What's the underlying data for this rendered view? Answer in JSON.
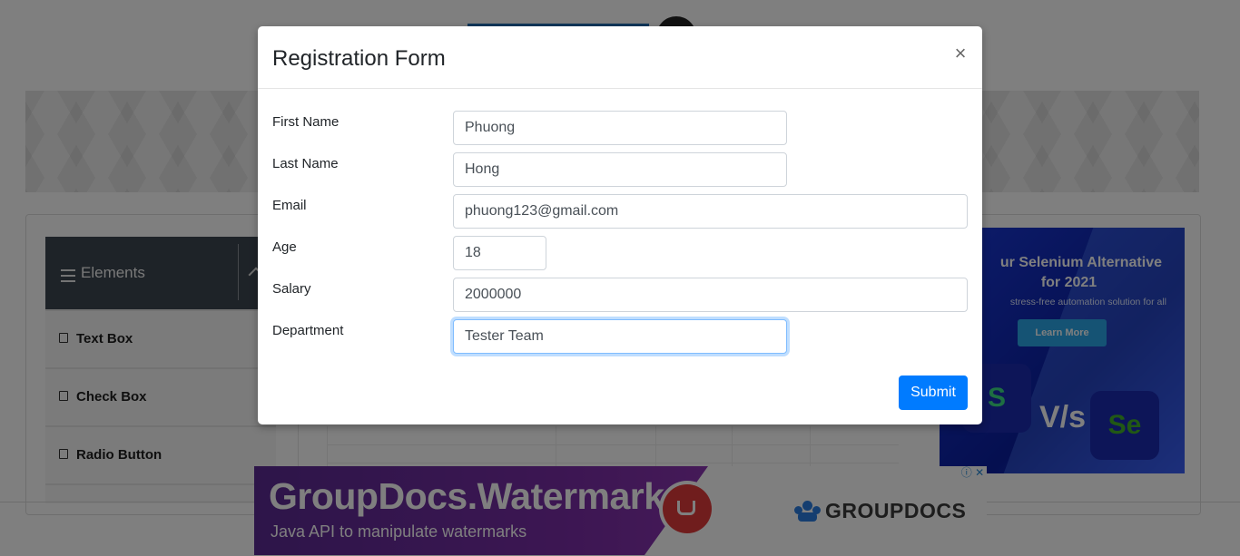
{
  "page": {
    "sidebar": {
      "group_title": "Elements",
      "items": [
        {
          "label": "Text Box"
        },
        {
          "label": "Check Box"
        },
        {
          "label": "Radio Button"
        }
      ]
    }
  },
  "ads": {
    "right": {
      "headline_line1": "ur Selenium Alternative",
      "headline_line2": "for 2021",
      "subtext": "stress-free automation solution for all",
      "button_label": "Learn More",
      "vs_text": "V/s",
      "tile_left_letter": "S",
      "tile_right_letter": "Se"
    },
    "bottom": {
      "title": "GroupDocs.Watermark",
      "subtitle": "Java API to manipulate watermarks",
      "brand": "GROUPDOCS"
    },
    "close_glyph": "ⓘ ✕"
  },
  "modal": {
    "title": "Registration Form",
    "close_glyph": "×",
    "fields": {
      "first_name": {
        "label": "First Name",
        "value": "Phuong"
      },
      "last_name": {
        "label": "Last Name",
        "value": "Hong"
      },
      "email": {
        "label": "Email",
        "value": "phuong123@gmail.com"
      },
      "age": {
        "label": "Age",
        "value": "18"
      },
      "salary": {
        "label": "Salary",
        "value": "2000000"
      },
      "department": {
        "label": "Department",
        "value": "Tester Team"
      }
    },
    "submit_label": "Submit"
  },
  "colors": {
    "primary": "#007bff",
    "overlay": "rgba(0,0,0,0.5)",
    "sidebar_header": "#3d4651"
  }
}
